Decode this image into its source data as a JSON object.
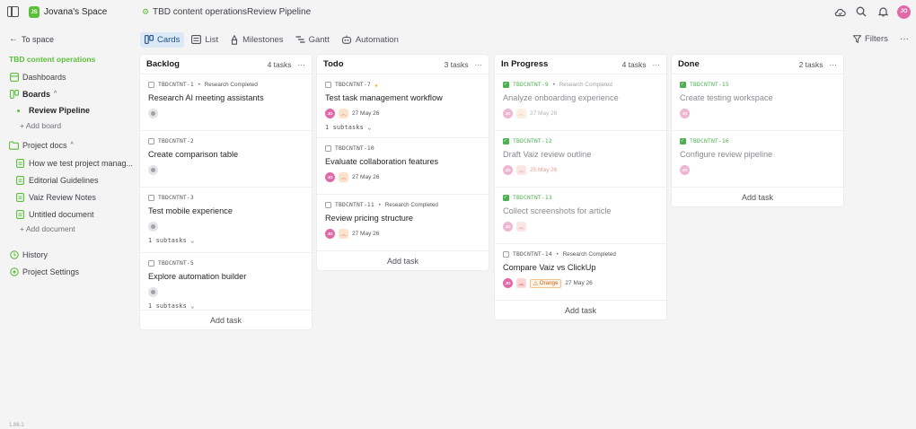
{
  "topbar": {
    "space_initials": "JS",
    "space_name": "Jovana's Space",
    "breadcrumb_project": "TBD content operations",
    "breadcrumb_separator": "›",
    "breadcrumb_board": "Review Pipeline",
    "user_initials": "JO",
    "icons": [
      "cloud-icon",
      "search-icon",
      "bell-icon"
    ]
  },
  "sidebar": {
    "back_label": "To space",
    "project_title": "TBD content operations",
    "dashboards": "Dashboards",
    "boards": "Boards",
    "board_item": "Review Pipeline",
    "add_board": "+ Add board",
    "project_docs": "Project docs",
    "docs": [
      "How we test project manag...",
      "Editorial Guidelines",
      "Vaiz Review Notes",
      "Untitled document"
    ],
    "add_document": "+ Add document",
    "history": "History",
    "settings": "Project Settings",
    "version": "1.86.1"
  },
  "views": {
    "tabs": [
      "Cards",
      "List",
      "Milestones",
      "Gantt",
      "Automation"
    ],
    "active": "Cards",
    "filters": "Filters",
    "more": "···"
  },
  "colors": {
    "accent_green": "#5bbf3a",
    "active_tab_bg": "#dbe9f7",
    "avatar_pink": "#e06aa8",
    "priority_medium": "#e8743b",
    "priority_high": "#d94a4a",
    "done_green": "#4caf50",
    "date_red": "#e0533d"
  },
  "board": {
    "add_task": "Add task",
    "columns": [
      {
        "title": "Backlog",
        "count": "4 tasks",
        "menu": "···",
        "cards": [
          {
            "key": "TBDCNTNT-1",
            "status": "Research Completed",
            "title": "Research AI meeting assistants",
            "assignee": "",
            "priority": "",
            "date": "",
            "subtasks": ""
          },
          {
            "key": "TBDCNTNT-2",
            "status": "",
            "title": "Create comparison table",
            "assignee": "",
            "priority": "",
            "date": "",
            "subtasks": ""
          },
          {
            "key": "TBDCNTNT-3",
            "status": "",
            "title": "Test mobile experience",
            "assignee": "",
            "priority": "",
            "date": "",
            "subtasks": "1 subtasks ⌄"
          },
          {
            "key": "TBDCNTNT-5",
            "status": "",
            "title": "Explore automation builder",
            "assignee": "",
            "priority": "",
            "date": "",
            "subtasks": "1 subtasks ⌄"
          }
        ]
      },
      {
        "title": "Todo",
        "count": "3 tasks",
        "menu": "···",
        "cards": [
          {
            "key": "TBDCNTNT-7",
            "status": "",
            "starred": true,
            "title": "Test task management workflow",
            "assignee": "JO",
            "priority": "medium",
            "date": "27 May 26",
            "subtasks": "1 subtasks ⌄"
          },
          {
            "key": "TBDCNTNT-10",
            "status": "",
            "title": "Evaluate collaboration features",
            "assignee": "JO",
            "priority": "medium",
            "date": "27 May 26",
            "subtasks": ""
          },
          {
            "key": "TBDCNTNT-11",
            "status": "Research Completed",
            "title": "Review pricing structure",
            "assignee": "JO",
            "priority": "medium",
            "date": "27 May 26",
            "subtasks": ""
          }
        ]
      },
      {
        "title": "In Progress",
        "count": "4 tasks",
        "menu": "···",
        "cards": [
          {
            "key": "TBDCNTNT-9",
            "done": true,
            "status": "Research Completed",
            "title": "Analyze onboarding experience",
            "assignee": "JO",
            "priority": "medium",
            "date": "27 May 26",
            "subtasks": ""
          },
          {
            "key": "TBDCNTNT-12",
            "done": true,
            "status": "",
            "title": "Draft Vaiz review outline",
            "assignee": "JO",
            "priority": "high",
            "date": "25 May 26",
            "date_red": true,
            "subtasks": ""
          },
          {
            "key": "TBDCNTNT-13",
            "done": true,
            "status": "",
            "title": "Collect screenshots for article",
            "assignee": "JO",
            "priority": "high",
            "date": "",
            "subtasks": ""
          },
          {
            "key": "TBDCNTNT-14",
            "status": "Research Completed",
            "title": "Compare Vaiz vs ClickUp",
            "assignee": "JO",
            "priority": "high",
            "tag": "Orange",
            "date": "27 May 26",
            "subtasks": ""
          }
        ]
      },
      {
        "title": "Done",
        "count": "2 tasks",
        "menu": "···",
        "cards": [
          {
            "key": "TBDCNTNT-15",
            "done": true,
            "status": "",
            "title": "Create testing workspace",
            "assignee": "JO",
            "priority": "",
            "date": "",
            "subtasks": ""
          },
          {
            "key": "TBDCNTNT-16",
            "done": true,
            "status": "",
            "title": "Configure review pipeline",
            "assignee": "JO",
            "priority": "",
            "date": "",
            "subtasks": ""
          }
        ]
      }
    ]
  }
}
